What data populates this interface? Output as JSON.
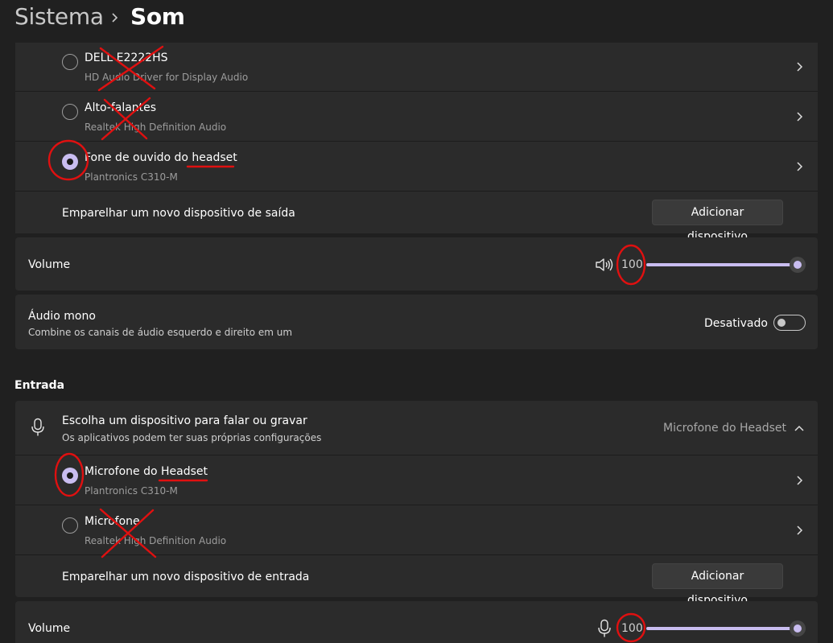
{
  "header": {
    "parent": "Sistema",
    "current": "Som"
  },
  "output": {
    "devices": [
      {
        "name": "DELL E2222HS",
        "subtitle": "HD Audio Driver for Display Audio",
        "selected": false
      },
      {
        "name": "Alto-falantes",
        "subtitle": "Realtek High Definition Audio",
        "selected": false
      },
      {
        "name": "Fone de ouvido do headset",
        "subtitle": "Plantronics C310-M",
        "selected": true
      }
    ],
    "pair_label": "Emparelhar um novo dispositivo de saída",
    "pair_button": "Adicionar dispositivo",
    "volume_label": "Volume",
    "volume_value": "100",
    "volume_icon": "speaker-icon"
  },
  "mono": {
    "title": "Áudio mono",
    "description": "Combine os canais de áudio esquerdo e direito em um",
    "state": "Desativado"
  },
  "input": {
    "section_title": "Entrada",
    "choose_title": "Escolha um dispositivo para falar ou gravar",
    "choose_subtitle": "Os aplicativos podem ter suas próprias configurações",
    "selected_device": "Microfone do Headset",
    "devices": [
      {
        "name": "Microfone do Headset",
        "subtitle": "Plantronics C310-M",
        "selected": true
      },
      {
        "name": "Microfone",
        "subtitle": "Realtek High Definition Audio",
        "selected": false
      }
    ],
    "pair_label": "Emparelhar um novo dispositivo de entrada",
    "pair_button": "Adicionar dispositivo",
    "volume_label": "Volume",
    "volume_value": "100",
    "volume_icon": "microphone-icon"
  },
  "colors": {
    "background": "#202020",
    "card": "#2b2b2b",
    "accent": "#c9bdf0",
    "annotation": "#e01010"
  }
}
